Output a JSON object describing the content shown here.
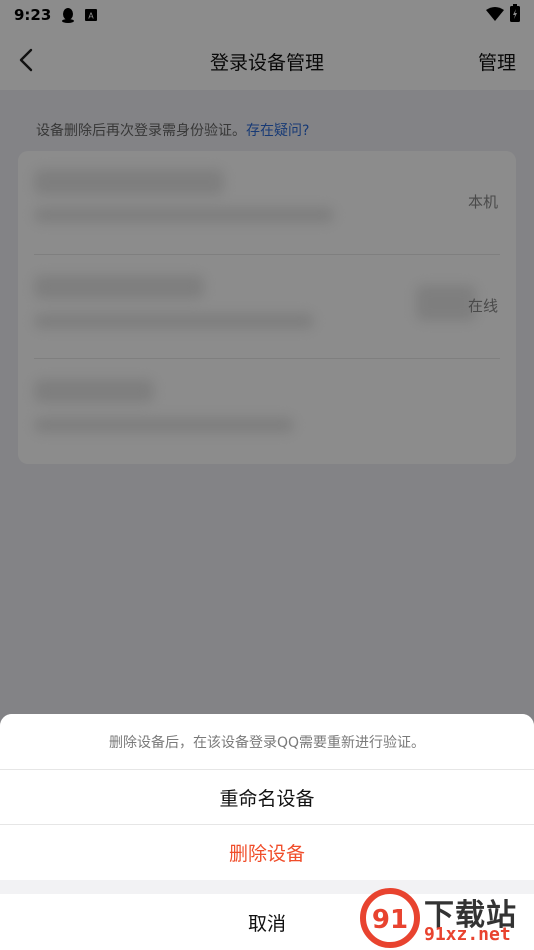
{
  "status_bar": {
    "time": "9:23"
  },
  "nav": {
    "title": "登录设备管理",
    "manage": "管理"
  },
  "hint": {
    "text": "设备删除后再次登录需身份验证。",
    "link": "存在疑问?"
  },
  "devices": [
    {
      "status": "本机"
    },
    {
      "status": "在线"
    },
    {
      "status": ""
    }
  ],
  "sheet": {
    "message": "删除设备后，在该设备登录QQ需要重新进行验证。",
    "rename": "重命名设备",
    "delete": "删除设备",
    "cancel": "取消"
  },
  "watermark": {
    "title": "下载站",
    "site": "91xz.net"
  },
  "colors": {
    "danger": "#f04d2a",
    "link": "#2d6bd6"
  }
}
